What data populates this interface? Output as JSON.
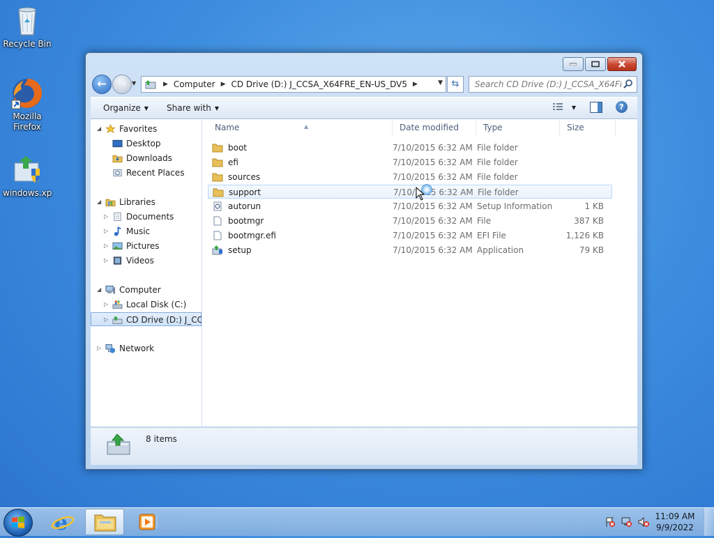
{
  "desktop": {
    "icons": [
      {
        "label": "Recycle Bin",
        "icon": "recycle-bin-icon"
      },
      {
        "label": "Mozilla Firefox",
        "icon": "firefox-icon"
      },
      {
        "label": "windows.xp",
        "icon": "shield-shortcut-icon"
      }
    ]
  },
  "window": {
    "caption_buttons": [
      "minimize",
      "maximize",
      "close"
    ],
    "address": {
      "crumbs": [
        "Computer",
        "CD Drive (D:) J_CCSA_X64FRE_EN-US_DV5"
      ]
    },
    "search": {
      "placeholder": "Search CD Drive (D:) J_CCSA_X64FRE_..."
    },
    "commands": {
      "organize": "Organize",
      "share_with": "Share with"
    },
    "nav_pane": {
      "favorites": {
        "label": "Favorites",
        "items": [
          "Desktop",
          "Downloads",
          "Recent Places"
        ]
      },
      "libraries": {
        "label": "Libraries",
        "items": [
          "Documents",
          "Music",
          "Pictures",
          "Videos"
        ]
      },
      "computer": {
        "label": "Computer",
        "items": [
          "Local Disk (C:)",
          "CD Drive (D:) J_CCSA"
        ]
      },
      "network": {
        "label": "Network"
      }
    },
    "columns": {
      "name": "Name",
      "date": "Date modified",
      "type": "Type",
      "size": "Size"
    },
    "files": [
      {
        "name": "boot",
        "date": "7/10/2015 6:32 AM",
        "type": "File folder",
        "size": "",
        "icon": "folder-icon"
      },
      {
        "name": "efi",
        "date": "7/10/2015 6:32 AM",
        "type": "File folder",
        "size": "",
        "icon": "folder-icon"
      },
      {
        "name": "sources",
        "date": "7/10/2015 6:32 AM",
        "type": "File folder",
        "size": "",
        "icon": "folder-icon"
      },
      {
        "name": "support",
        "date": "7/10/2015 6:32 AM",
        "type": "File folder",
        "size": "",
        "icon": "folder-icon"
      },
      {
        "name": "autorun",
        "date": "7/10/2015 6:32 AM",
        "type": "Setup Information",
        "size": "1 KB",
        "icon": "settings-file-icon"
      },
      {
        "name": "bootmgr",
        "date": "7/10/2015 6:32 AM",
        "type": "File",
        "size": "387 KB",
        "icon": "file-icon"
      },
      {
        "name": "bootmgr.efi",
        "date": "7/10/2015 6:32 AM",
        "type": "EFI File",
        "size": "1,126 KB",
        "icon": "file-icon"
      },
      {
        "name": "setup",
        "date": "7/10/2015 6:32 AM",
        "type": "Application",
        "size": "79 KB",
        "icon": "setup-app-icon"
      }
    ],
    "status": {
      "item_count": "8 items"
    }
  },
  "taskbar": {
    "clock": {
      "time": "11:09 AM",
      "date": "9/9/2022"
    }
  },
  "colors": {
    "folder": "#e8c05a",
    "accent": "#3d8ddf",
    "selection": "#cfe2f8"
  }
}
